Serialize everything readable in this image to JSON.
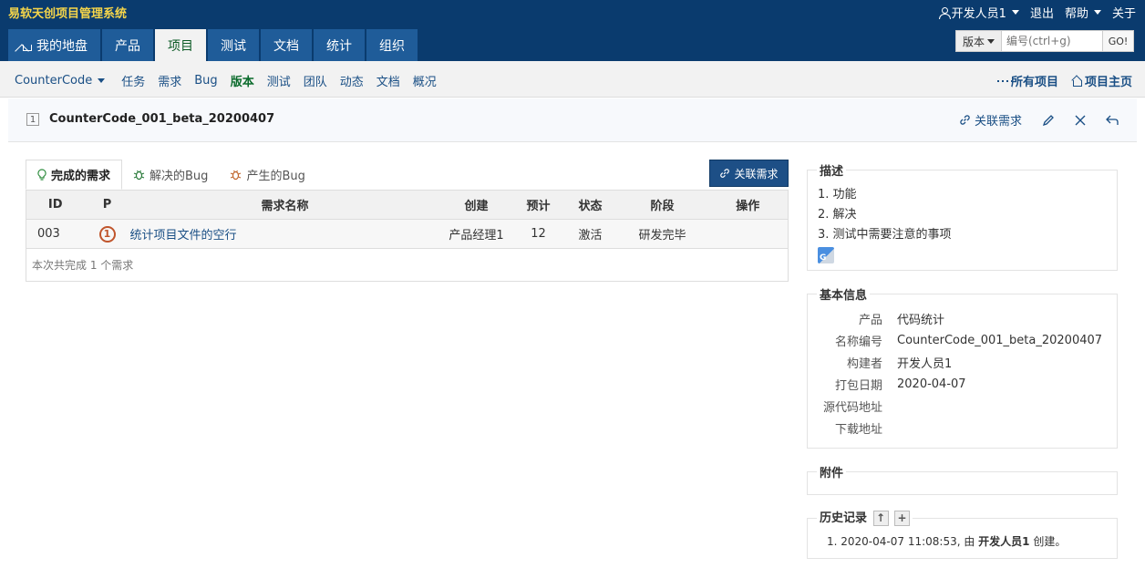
{
  "app": {
    "title": "易软天创项目管理系统"
  },
  "topnav": {
    "user": "开发人员1",
    "logout": "退出",
    "help": "帮助",
    "about": "关于"
  },
  "mainnav": {
    "tabs": [
      "我的地盘",
      "产品",
      "项目",
      "测试",
      "文档",
      "统计",
      "组织"
    ],
    "active": "项目"
  },
  "search": {
    "type_label": "版本",
    "placeholder": "编号(ctrl+g)",
    "go_label": "GO!"
  },
  "subnav": {
    "project": "CounterCode",
    "items": [
      "任务",
      "需求",
      "Bug",
      "版本",
      "测试",
      "团队",
      "动态",
      "文档",
      "概况"
    ],
    "active": "版本",
    "all_projects": "所有项目",
    "project_home": "项目主页"
  },
  "build": {
    "id": "1",
    "name": "CounterCode_001_beta_20200407",
    "link_story": "关联需求"
  },
  "tabs": [
    "完成的需求",
    "解决的Bug",
    "产生的Bug"
  ],
  "link_story_button": "关联需求",
  "table": {
    "headers": [
      "ID",
      "P",
      "需求名称",
      "创建",
      "预计",
      "状态",
      "阶段",
      "操作"
    ],
    "rows": [
      {
        "id": "003",
        "pri": "1",
        "name": "统计项目文件的空行",
        "creator": "产品经理1",
        "estimate": "12",
        "status": "激活",
        "stage": "研发完毕",
        "actions": ""
      }
    ],
    "summary": "本次共完成 1 个需求"
  },
  "description": {
    "title": "描述",
    "lines": [
      "1. 功能",
      "2. 解决",
      "3. 测试中需要注意的事项"
    ]
  },
  "basic_info": {
    "title": "基本信息",
    "rows": [
      {
        "k": "产品",
        "v": "代码统计"
      },
      {
        "k": "名称编号",
        "v": "CounterCode_001_beta_20200407"
      },
      {
        "k": "构建者",
        "v": "开发人员1"
      },
      {
        "k": "打包日期",
        "v": "2020-04-07"
      },
      {
        "k": "源代码地址",
        "v": ""
      },
      {
        "k": "下载地址",
        "v": ""
      }
    ]
  },
  "attachments": {
    "title": "附件"
  },
  "history": {
    "title": "历史记录",
    "entry_prefix": "1. 2020-04-07 11:08:53, 由 ",
    "entry_user": "开发人员1",
    "entry_suffix": " 创建。"
  }
}
